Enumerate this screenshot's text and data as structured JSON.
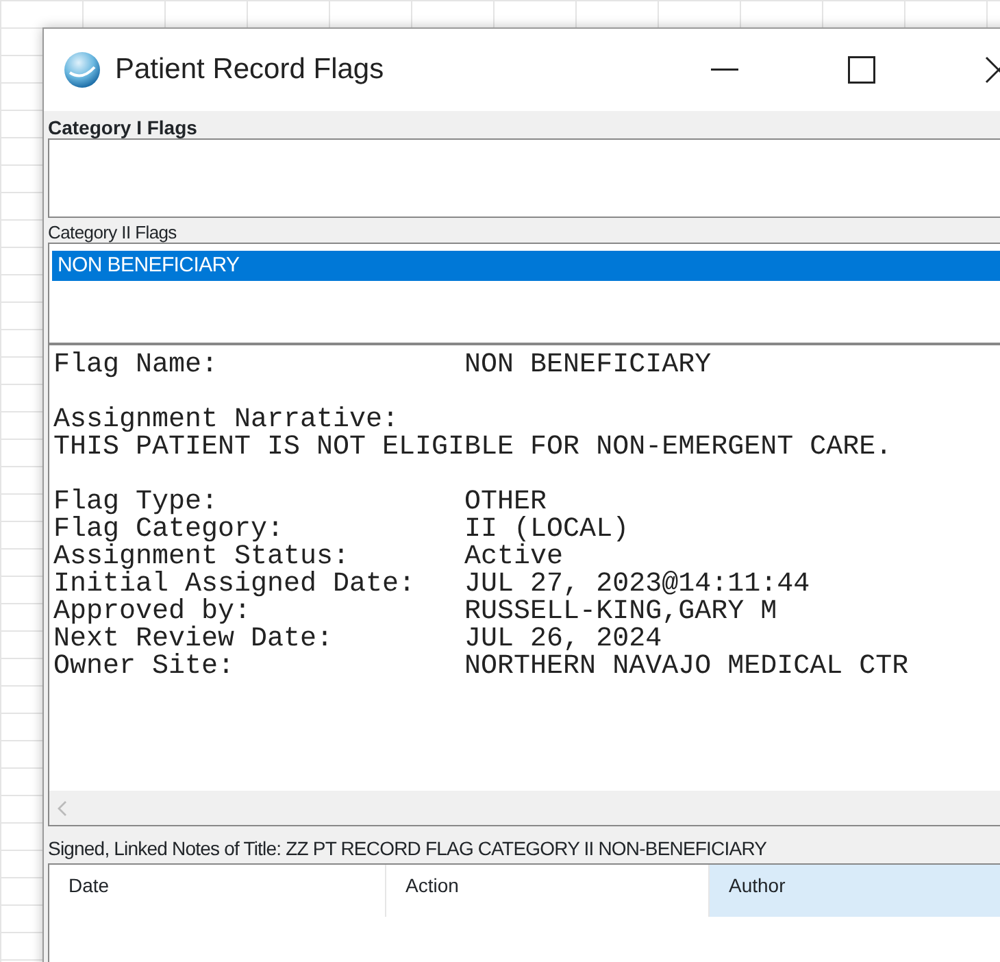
{
  "window": {
    "title": "Patient Record Flags"
  },
  "category_1": {
    "label": "Category I Flags"
  },
  "category_2": {
    "label": "Category II Flags",
    "items": [
      {
        "text": "NON BENEFICIARY",
        "selected": true
      }
    ]
  },
  "details": {
    "sections": [
      [
        {
          "label": "Flag Name:",
          "value": "NON BENEFICIARY"
        }
      ],
      [
        {
          "label": "Assignment Narrative:"
        },
        {
          "text": "THIS PATIENT IS NOT ELIGIBLE FOR NON-EMERGENT CARE."
        }
      ],
      [
        {
          "label": "Flag Type:",
          "value": "OTHER"
        },
        {
          "label": "Flag Category:",
          "value": "II (LOCAL)"
        },
        {
          "label": "Assignment Status:",
          "value": "Active"
        },
        {
          "label": "Initial Assigned Date:",
          "value": "JUL 27, 2023@14:11:44"
        },
        {
          "label": "Approved by:",
          "value": "RUSSELL-KING,GARY M"
        },
        {
          "label": "Next Review Date:",
          "value": "JUL 26, 2024"
        },
        {
          "label": "Owner Site:",
          "value": "NORTHERN NAVAJO MEDICAL CTR"
        }
      ]
    ]
  },
  "notes": {
    "title": "Signed, Linked Notes of Title: ZZ PT RECORD FLAG CATEGORY II NON-BENEFICIARY",
    "columns": [
      {
        "label": "Date",
        "selected": false
      },
      {
        "label": "Action",
        "selected": false
      },
      {
        "label": "Author",
        "selected": true
      }
    ]
  }
}
